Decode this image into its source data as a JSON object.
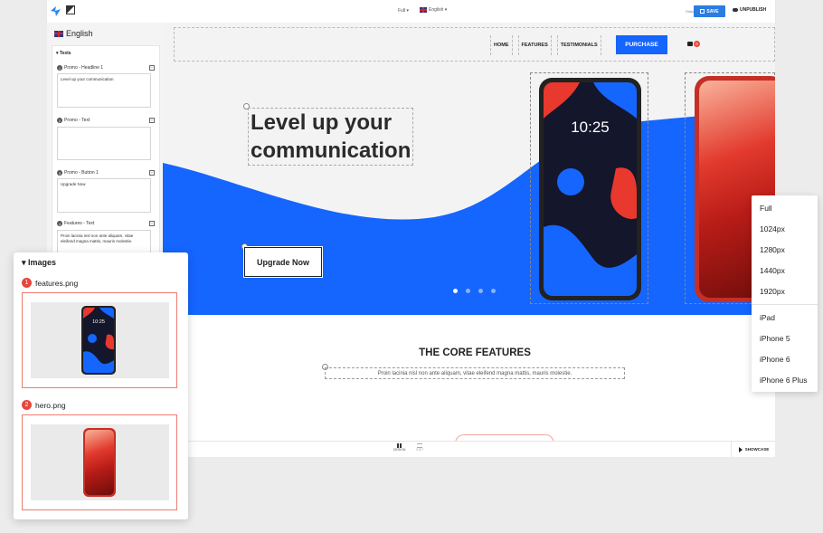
{
  "topbar": {
    "view_select": "Full ▾",
    "language_select": "English ▾",
    "status": "Status: Published",
    "save_label": "SAVE",
    "unpublish_label": "UNPUBLISH"
  },
  "left_panel": {
    "language": "English",
    "texts_section": "▾ Texts",
    "fields": [
      {
        "num": "1",
        "label": "Promo - Headline 1",
        "value": "Level up your communication"
      },
      {
        "num": "2",
        "label": "Promo - Text",
        "value": ""
      },
      {
        "num": "3",
        "label": "Promo - Button 1",
        "value": "Upgrade Now"
      },
      {
        "num": "4",
        "label": "Features - Text",
        "value": "Proin lacinia nisl non ante aliquam, vitae eleifend magna mattis, mauris molestie."
      }
    ]
  },
  "site": {
    "nav": [
      "HOME",
      "FEATURES",
      "TESTIMONIALS"
    ],
    "purchase_label": "PURCHASE",
    "cart_count": "0",
    "headline_line1": "Level up your",
    "headline_line2": "communication",
    "button_label": "Upgrade Now",
    "phone_time": "10:25",
    "core_title": "THE CORE FEATURES",
    "core_text": "Proin lacinia nisl non ante aliquam, vitae eleifend magna mattis, mauris molestie."
  },
  "bottombar": {
    "design_label": "DESIGN",
    "edit_label": "EDIT",
    "showcase_label": "SHOWCASE"
  },
  "size_menu": {
    "items": [
      "Full",
      "1024px",
      "1280px",
      "1440px",
      "1920px"
    ],
    "devices": [
      "iPad",
      "iPhone 5",
      "iPhone 6",
      "iPhone 6 Plus"
    ]
  },
  "images_panel": {
    "title": "▾ Images",
    "items": [
      {
        "num": "1",
        "name": "features.png",
        "phone_time": "10:25"
      },
      {
        "num": "2",
        "name": "hero.png"
      }
    ]
  },
  "colors": {
    "accent": "#1565ff",
    "save": "#2a7de1",
    "badge": "#e8453c"
  }
}
